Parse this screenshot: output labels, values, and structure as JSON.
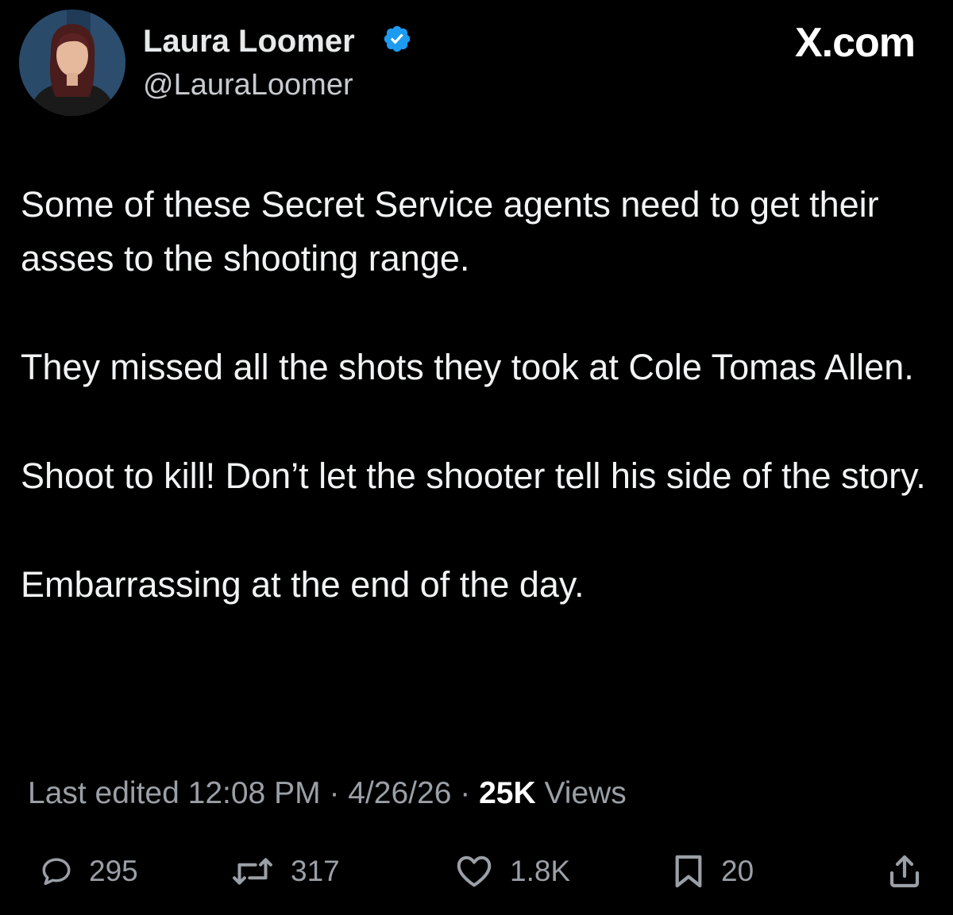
{
  "header": {
    "display_name": "Laura Loomer",
    "handle": "@LauraLoomer",
    "verified": true,
    "verified_icon": "verified-badge-icon",
    "brand": "X.com"
  },
  "tweet": {
    "paragraphs": [
      "Some of these Secret Service agents need to get their asses to the shooting range.",
      "They missed all the shots they took at Cole Tomas Allen.",
      "Shoot to kill! Don’t let the shooter tell his side of the story.",
      "Embarrassing at the end of the day."
    ]
  },
  "meta": {
    "edited_label": "Last edited",
    "time": "12:08 PM",
    "separator": "·",
    "date": "4/26/26",
    "views_count": "25K",
    "views_label": "Views"
  },
  "actions": {
    "replies": "295",
    "reposts": "317",
    "likes": "1.8K",
    "bookmarks": "20"
  },
  "colors": {
    "background": "#000000",
    "text": "#e7e9ea",
    "muted": "#9aa0a6",
    "verified": "#1d9bf0"
  }
}
